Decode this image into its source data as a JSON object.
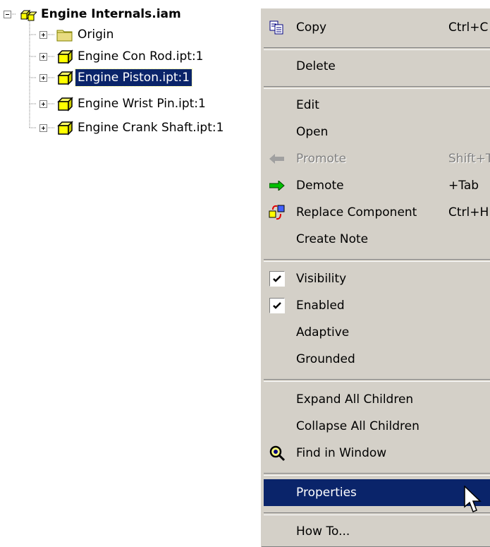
{
  "tree": {
    "root": {
      "label": "Engine Internals.iam"
    },
    "children": [
      {
        "label": "Origin"
      },
      {
        "label": "Engine Con Rod.ipt:1"
      },
      {
        "label": "Engine Piston.ipt:1"
      },
      {
        "label": "Engine Wrist Pin.ipt:1"
      },
      {
        "label": "Engine Crank Shaft.ipt:1"
      }
    ],
    "selected_index": 2
  },
  "menu": {
    "copy": {
      "label": "Copy",
      "shortcut": "Ctrl+C"
    },
    "delete": {
      "label": "Delete"
    },
    "edit": {
      "label": "Edit"
    },
    "open": {
      "label": "Open"
    },
    "promote": {
      "label": "Promote",
      "shortcut": "Shift+Tab"
    },
    "demote": {
      "label": "Demote",
      "shortcut": "+Tab"
    },
    "replace": {
      "label": "Replace Component",
      "shortcut": "Ctrl+H"
    },
    "note": {
      "label": "Create Note"
    },
    "visibility": {
      "label": "Visibility",
      "checked": true
    },
    "enabled": {
      "label": "Enabled",
      "checked": true
    },
    "adaptive": {
      "label": "Adaptive"
    },
    "grounded": {
      "label": "Grounded"
    },
    "expand": {
      "label": "Expand All Children"
    },
    "collapse": {
      "label": "Collapse All Children"
    },
    "find": {
      "label": "Find in Window"
    },
    "properties": {
      "label": "Properties",
      "highlighted": true
    },
    "howto": {
      "label": "How To..."
    }
  },
  "colors": {
    "menu_bg": "#d4d0c8",
    "highlight": "#0a246a",
    "folder": "#f0e68c",
    "part": "#ffff00"
  }
}
